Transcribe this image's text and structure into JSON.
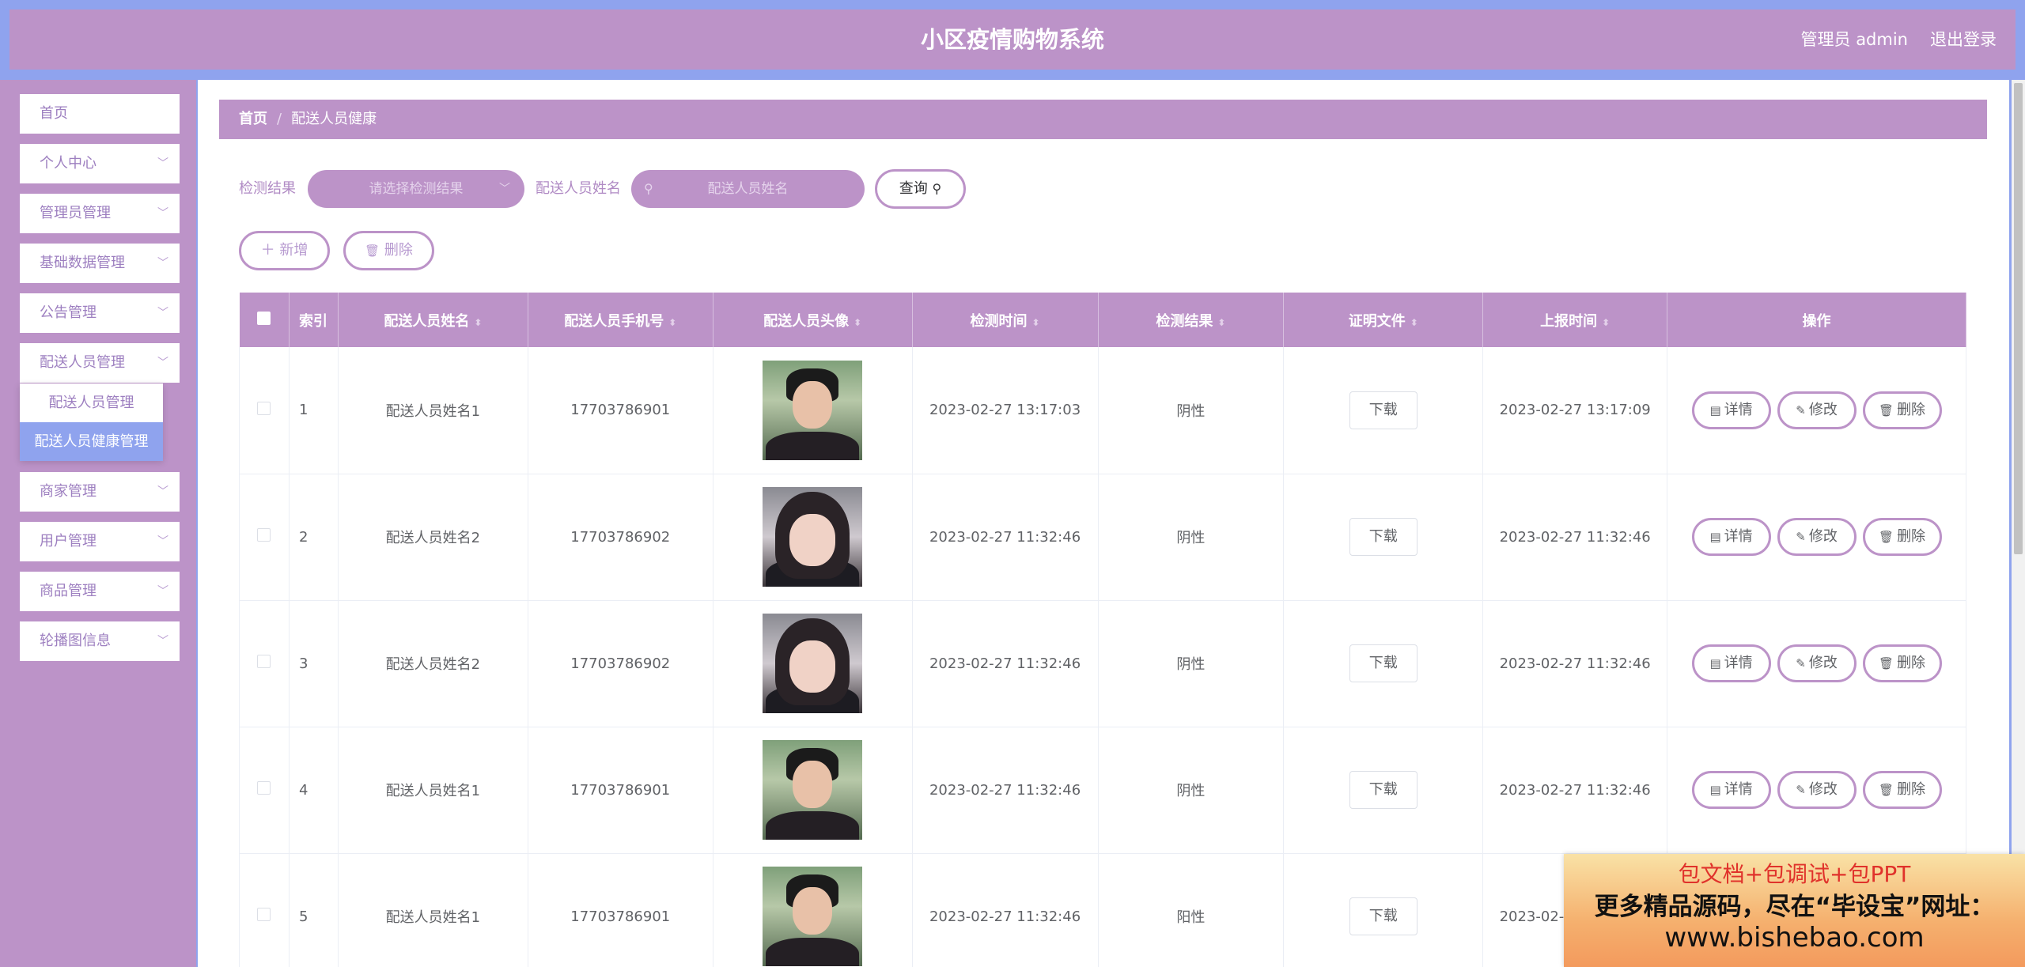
{
  "app": {
    "title": "小区疫情购物系统",
    "user_label": "管理员 admin",
    "logout_label": "退出登录"
  },
  "sidebar": {
    "items": [
      {
        "label": "首页",
        "has_chevron": false
      },
      {
        "label": "个人中心",
        "has_chevron": true
      },
      {
        "label": "管理员管理",
        "has_chevron": true
      },
      {
        "label": "基础数据管理",
        "has_chevron": true
      },
      {
        "label": "公告管理",
        "has_chevron": true
      },
      {
        "label": "配送人员管理",
        "has_chevron": true
      },
      {
        "label": "商家管理",
        "has_chevron": true
      },
      {
        "label": "用户管理",
        "has_chevron": true
      },
      {
        "label": "商品管理",
        "has_chevron": true
      },
      {
        "label": "轮播图信息",
        "has_chevron": true
      }
    ],
    "submenu": [
      {
        "label": "配送人员管理",
        "active": false
      },
      {
        "label": "配送人员健康管理",
        "active": true
      }
    ]
  },
  "breadcrumb": {
    "home": "首页",
    "separator": "/",
    "current": "配送人员健康"
  },
  "filters": {
    "result_label": "检测结果",
    "result_placeholder": "请选择检测结果",
    "name_label": "配送人员姓名",
    "name_placeholder": "配送人员姓名",
    "query_button": "查询"
  },
  "actions": {
    "add_button": "新增",
    "delete_button": "删除"
  },
  "table": {
    "headers": [
      "索引",
      "配送人员姓名",
      "配送人员手机号",
      "配送人员头像",
      "检测时间",
      "检测结果",
      "证明文件",
      "上报时间",
      "操作"
    ],
    "download_label": "下载",
    "op_labels": {
      "detail": "详情",
      "edit": "修改",
      "delete": "删除"
    },
    "rows": [
      {
        "index": "1",
        "name": "配送人员姓名1",
        "phone": "17703786901",
        "avatar": "male",
        "test_time": "2023-02-27 13:17:03",
        "result": "阴性",
        "report_time": "2023-02-27 13:17:09"
      },
      {
        "index": "2",
        "name": "配送人员姓名2",
        "phone": "17703786902",
        "avatar": "female",
        "test_time": "2023-02-27 11:32:46",
        "result": "阴性",
        "report_time": "2023-02-27 11:32:46"
      },
      {
        "index": "3",
        "name": "配送人员姓名2",
        "phone": "17703786902",
        "avatar": "female",
        "test_time": "2023-02-27 11:32:46",
        "result": "阴性",
        "report_time": "2023-02-27 11:32:46"
      },
      {
        "index": "4",
        "name": "配送人员姓名1",
        "phone": "17703786901",
        "avatar": "male",
        "test_time": "2023-02-27 11:32:46",
        "result": "阴性",
        "report_time": "2023-02-27 11:32:46"
      },
      {
        "index": "5",
        "name": "配送人员姓名1",
        "phone": "17703786901",
        "avatar": "male",
        "test_time": "2023-02-27 11:32:46",
        "result": "阳性",
        "report_time": "2023-02-27 11:32:46"
      }
    ]
  },
  "ad_banner": {
    "line1": "包文档+包调试+包PPT",
    "line2": "更多精品源码，尽在“毕设宝”网址：",
    "line3": "www.bishebao.com"
  },
  "colors": {
    "primary": "#bc93c8",
    "accent_blue": "#8fa3ee",
    "text": "#606266"
  }
}
